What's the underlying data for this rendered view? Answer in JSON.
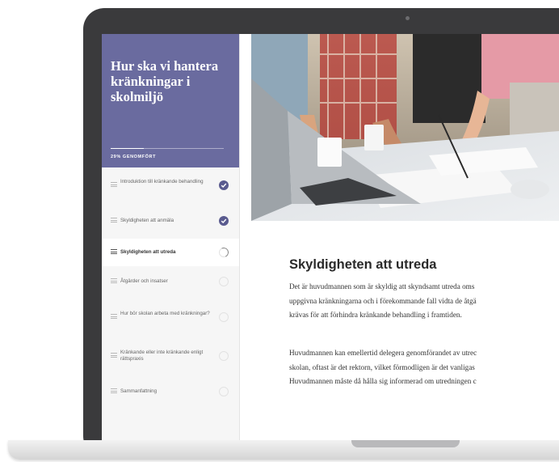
{
  "course": {
    "title": "Hur ska vi hantera kränkningar i skolmiljö",
    "progress_label": "29% GENOMFÖRT",
    "progress_fraction": 0.29
  },
  "lessons": [
    {
      "label": "Introduktion till kränkande behandling",
      "status": "done"
    },
    {
      "label": "Skyldigheten att anmäla",
      "status": "done"
    },
    {
      "label": "Skyldigheten att utreda",
      "status": "in-progress",
      "active": true
    },
    {
      "label": "Åtgärder och insatser",
      "status": "not-started"
    },
    {
      "label": "Hur bör skolan arbeta med kränkningar?",
      "status": "not-started"
    },
    {
      "label": "Kränkande eller inte kränkande enligt rättspraxis",
      "status": "not-started"
    },
    {
      "label": "Sammanfattning",
      "status": "not-started"
    }
  ],
  "content": {
    "title": "Skyldigheten att utreda",
    "paragraph1_lines": [
      "Det är huvudmannen som är skyldig att skyndsamt utreda oms",
      "uppgivna kränkningarna och i förekommande fall vidta de åtgä",
      "krävas för att förhindra kränkande behandling i framtiden."
    ],
    "paragraph2_lines": [
      "Huvudmannen kan emellertid delegera genomförandet av utrec",
      "skolan, oftast är det rektorn, vilket förmodligen är det vanligas",
      "Huvudmannen måste då hålla sig informerad om utredningen c"
    ]
  },
  "colors": {
    "sidebar_header": "#6a6b9f",
    "check_done": "#5a5b8f",
    "laptop_bezel": "#3a3a3c"
  },
  "icons": {
    "lesson_marker": "lines-icon",
    "done": "check-circle-icon",
    "in_progress": "progress-ring-icon",
    "not_started": "empty-circle-icon"
  }
}
